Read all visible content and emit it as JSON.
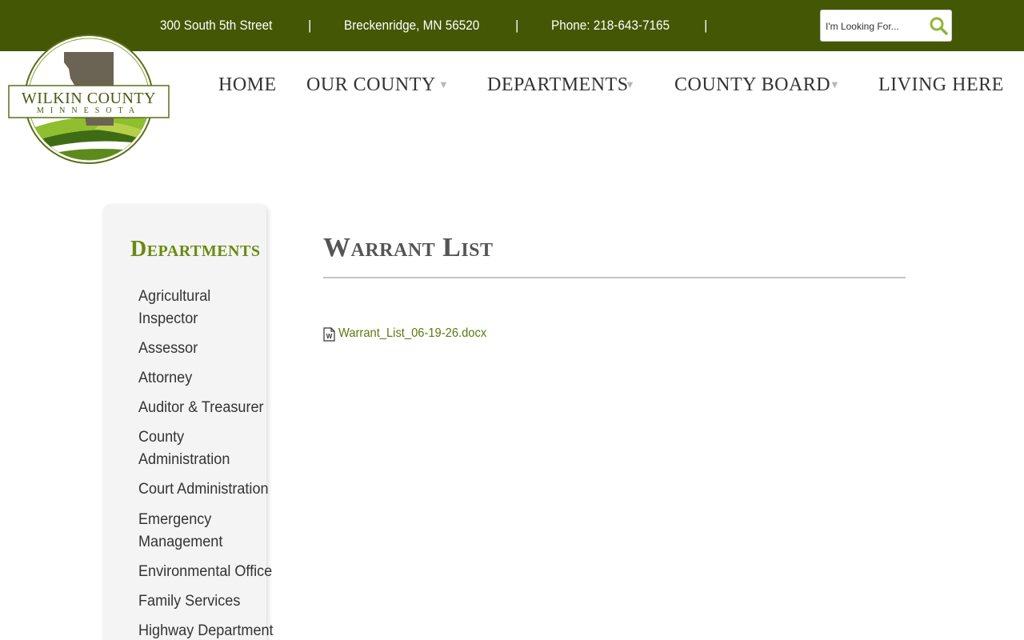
{
  "topbar": {
    "address": "300 South 5th Street",
    "city": "Breckenridge, MN 56520",
    "phone": "Phone: 218-643-7165",
    "separator": "|",
    "search_placeholder": "I'm Looking For...",
    "background_color": "#445705"
  },
  "logo": {
    "name": "WILKIN COUNTY",
    "state": "MINNESOTA"
  },
  "nav": {
    "home": "HOME",
    "our_county": "OUR COUNTY",
    "departments": "DEPARTMENTS",
    "county_board": "COUNTY BOARD",
    "living_here": "LIVING HERE",
    "dropdown_arrow": "▼"
  },
  "sidebar": {
    "title": "Departments",
    "items": [
      {
        "line1": "Agricultural",
        "line2": "Inspector"
      },
      {
        "line1": "Assessor"
      },
      {
        "line1": "Attorney"
      },
      {
        "line1": "Auditor & Treasurer"
      },
      {
        "line1": "County",
        "line2": "Administration"
      },
      {
        "line1": "Court Administration"
      },
      {
        "line1": "Emergency",
        "line2": "Management"
      },
      {
        "line1": "Environmental Office"
      },
      {
        "line1": "Family Services"
      },
      {
        "line1": "Highway Department"
      }
    ]
  },
  "content": {
    "title": "Warrant List",
    "document": "Warrant_List_06-19-26.docx"
  },
  "colors": {
    "accent_green": "#6a8a10",
    "link_green": "#5a7a10",
    "dark_green": "#445705"
  }
}
